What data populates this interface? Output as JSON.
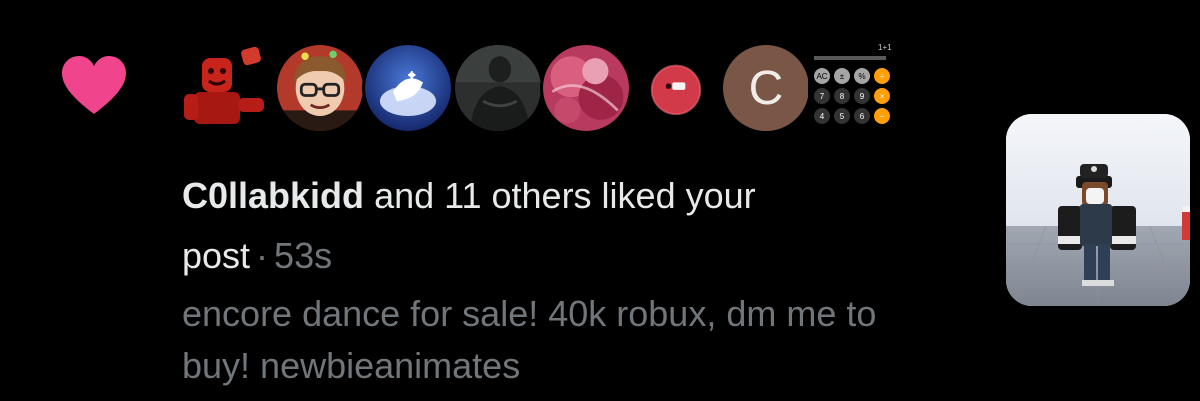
{
  "notification": {
    "type": "like",
    "icon": "heart-icon",
    "accent_color": "#f91880",
    "liker_name": "C0llabkidd",
    "text_suffix": "and 11 others liked your",
    "text_object": "post",
    "separator": "·",
    "time_ago": "53s",
    "post_preview": "encore dance for sale! 40k robux, dm me to buy! newbieanimates",
    "avatars": [
      {
        "name": "red-character-avatar",
        "kind": "image"
      },
      {
        "name": "cartoon-glasses-avatar",
        "kind": "image"
      },
      {
        "name": "blue-bird-avatar",
        "kind": "image"
      },
      {
        "name": "dark-figure-avatar",
        "kind": "image"
      },
      {
        "name": "pink-abstract-avatar",
        "kind": "image"
      },
      {
        "name": "red-blob-avatar",
        "kind": "image"
      },
      {
        "name": "letter-avatar",
        "kind": "letter",
        "letter": "C",
        "color": "#7a5647"
      },
      {
        "name": "calculator-avatar",
        "kind": "image"
      }
    ],
    "thumbnail": "roblox-character-thumbnail"
  }
}
